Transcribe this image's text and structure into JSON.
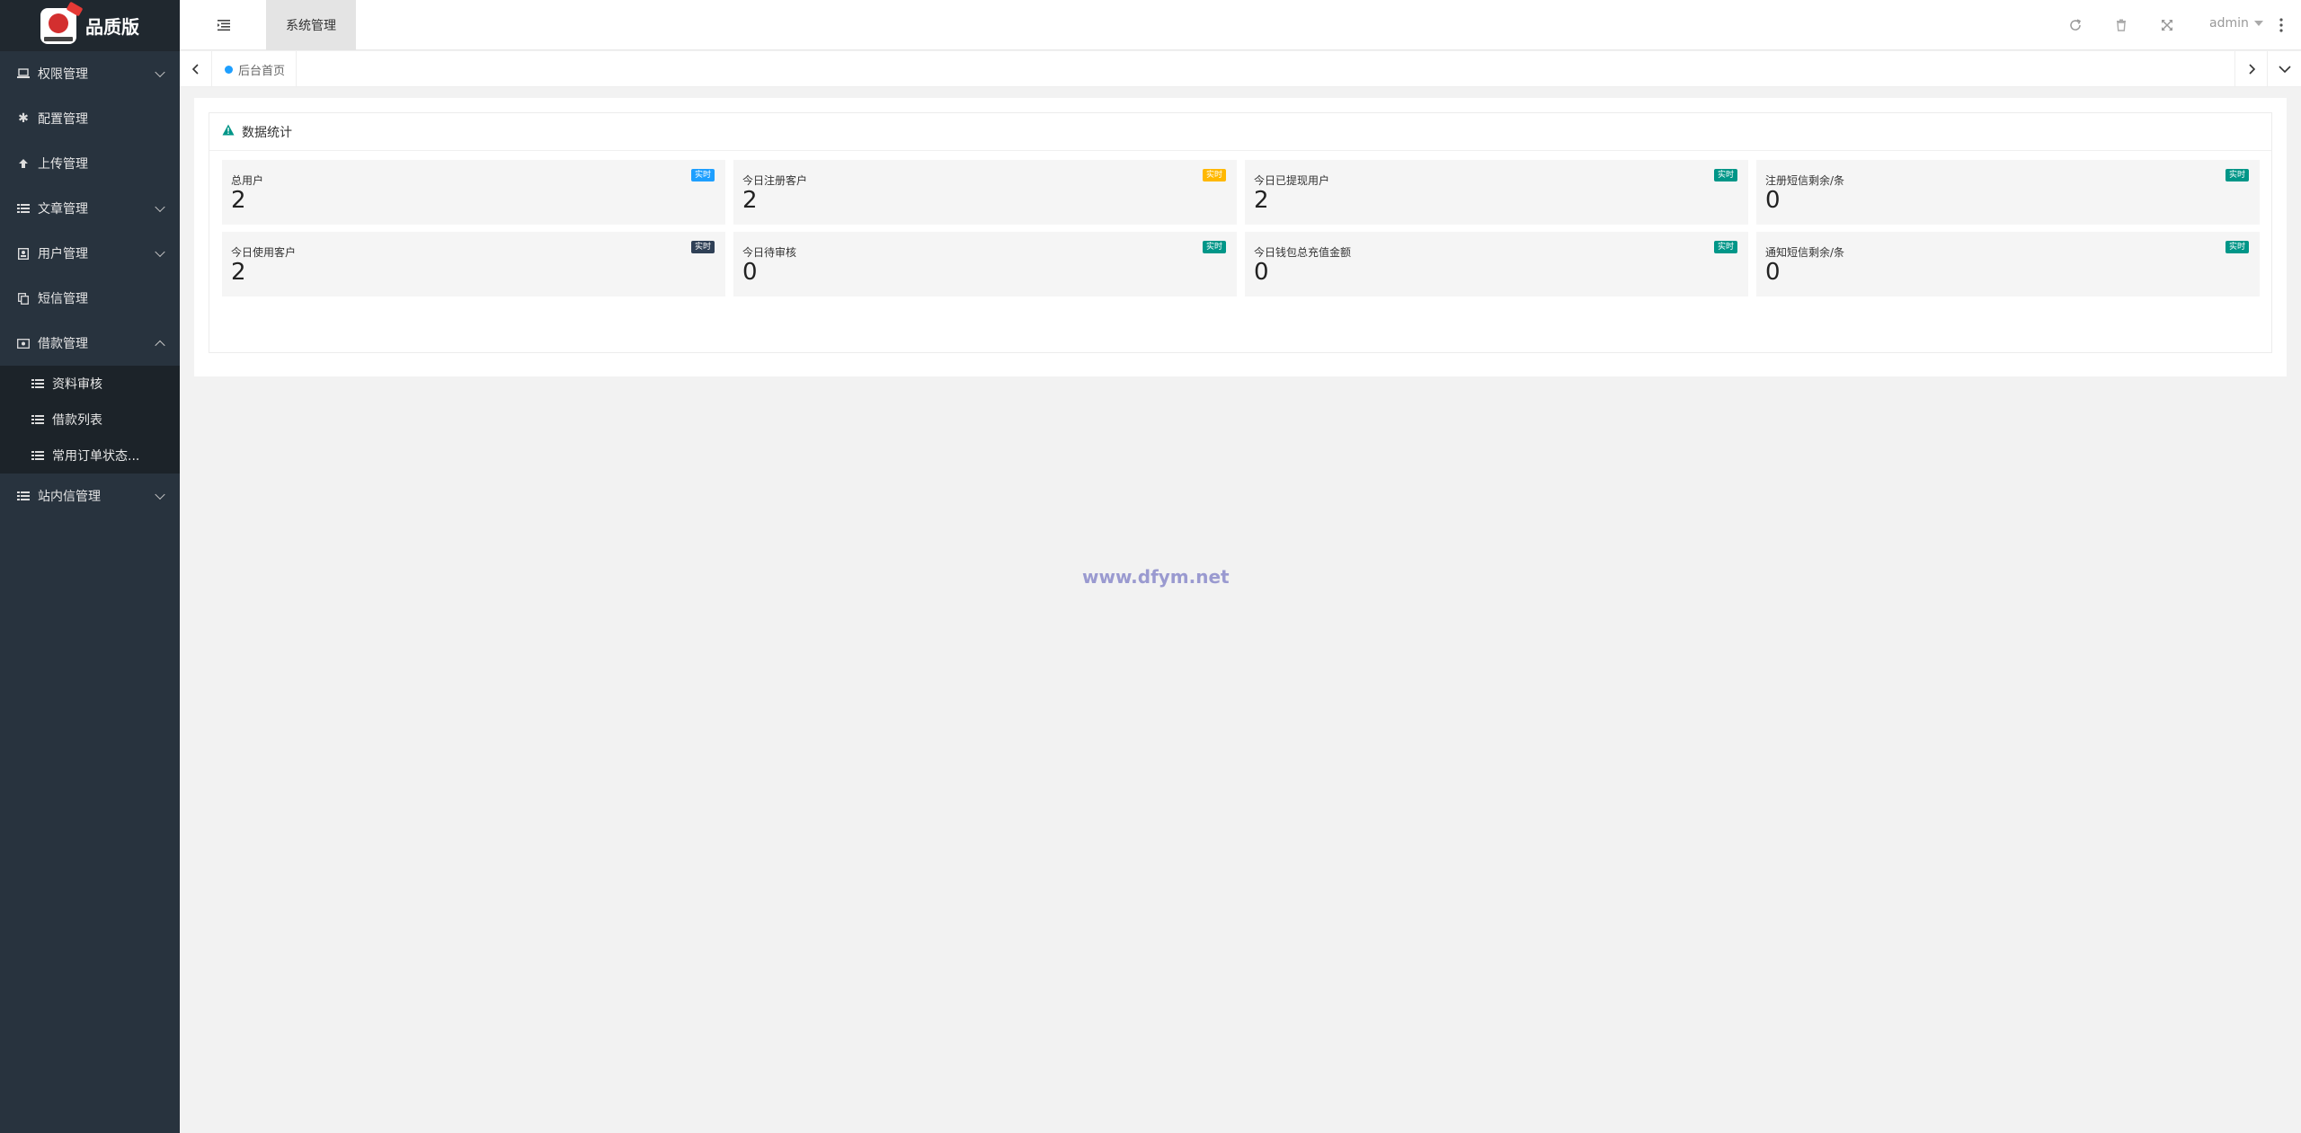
{
  "logo": {
    "text": "品质版"
  },
  "sidebar": {
    "items": [
      {
        "label": "权限管理",
        "icon": "laptop-icon",
        "expandable": true
      },
      {
        "label": "配置管理",
        "icon": "asterisk-icon",
        "expandable": false
      },
      {
        "label": "上传管理",
        "icon": "arrow-up-icon",
        "expandable": false
      },
      {
        "label": "文章管理",
        "icon": "list-icon",
        "expandable": true
      },
      {
        "label": "用户管理",
        "icon": "user-card-icon",
        "expandable": true
      },
      {
        "label": "短信管理",
        "icon": "copy-icon",
        "expandable": false
      },
      {
        "label": "借款管理",
        "icon": "money-icon",
        "expandable": true,
        "expanded": true
      },
      {
        "label": "站内信管理",
        "icon": "list-icon",
        "expandable": true
      }
    ],
    "submenu": [
      {
        "label": "资料审核"
      },
      {
        "label": "借款列表"
      },
      {
        "label": "常用订单状态..."
      }
    ]
  },
  "header": {
    "tab_label": "系统管理",
    "user": "admin"
  },
  "tabs": {
    "home_label": "后台首页"
  },
  "panel": {
    "title": "数据统计",
    "cards": [
      {
        "label": "总用户",
        "value": "2",
        "badge": "实时",
        "badge_color": "#1e9fff"
      },
      {
        "label": "今日注册客户",
        "value": "2",
        "badge": "实时",
        "badge_color": "#ffb800"
      },
      {
        "label": "今日已提现用户",
        "value": "2",
        "badge": "实时",
        "badge_color": "#009688"
      },
      {
        "label": "注册短信剩余/条",
        "value": "0",
        "badge": "实时",
        "badge_color": "#009688"
      },
      {
        "label": "今日使用客户",
        "value": "2",
        "badge": "实时",
        "badge_color": "#2f4056"
      },
      {
        "label": "今日待审核",
        "value": "0",
        "badge": "实时",
        "badge_color": "#009688"
      },
      {
        "label": "今日钱包总充值金额",
        "value": "0",
        "badge": "实时",
        "badge_color": "#009688"
      },
      {
        "label": "通知短信剩余/条",
        "value": "0",
        "badge": "实时",
        "badge_color": "#009688"
      }
    ]
  },
  "watermark": "www.dfym.net"
}
